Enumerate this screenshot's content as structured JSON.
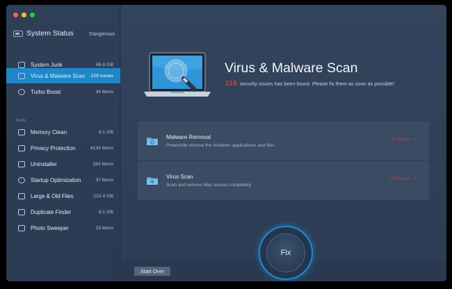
{
  "sidebar": {
    "status": {
      "title": "System Status",
      "value": "Dangerous"
    },
    "top_items": [
      {
        "label": "System Junk",
        "value": "65.8 GB"
      },
      {
        "label": "Virus & Malware Scan",
        "value": "219 issues"
      },
      {
        "label": "Turbo Boost",
        "value": "34 items"
      }
    ],
    "tools_label": "Tools",
    "tools": [
      {
        "label": "Memory Clean",
        "value": "8.1 GB"
      },
      {
        "label": "Privacy Protection",
        "value": "4134 items"
      },
      {
        "label": "Uninstaller",
        "value": "262 items"
      },
      {
        "label": "Startup Optimization",
        "value": "37 items"
      },
      {
        "label": "Large & Old Files",
        "value": "222.4 GB"
      },
      {
        "label": "Duplicate Finder",
        "value": "8.1 GB"
      },
      {
        "label": "Photo Sweeper",
        "value": "23 items"
      }
    ]
  },
  "main": {
    "title": "Virus & Malware Scan",
    "subtitle_count": "219",
    "subtitle_text": "security issues has been found. Please fix them as soon as possible!",
    "rows": [
      {
        "title": "Malware Removal",
        "desc": "Powerfully remove the stubborn applications and files.",
        "issues": "45 issues"
      },
      {
        "title": "Virus Scan",
        "desc": "Scan and remove Mac viruses completely.",
        "issues": "174 issues"
      }
    ],
    "start_over_label": "Start Over",
    "fix_label": "Fix"
  },
  "colors": {
    "accent": "#1d87c9",
    "danger": "#e23b3b",
    "background": "#2a3a52"
  }
}
